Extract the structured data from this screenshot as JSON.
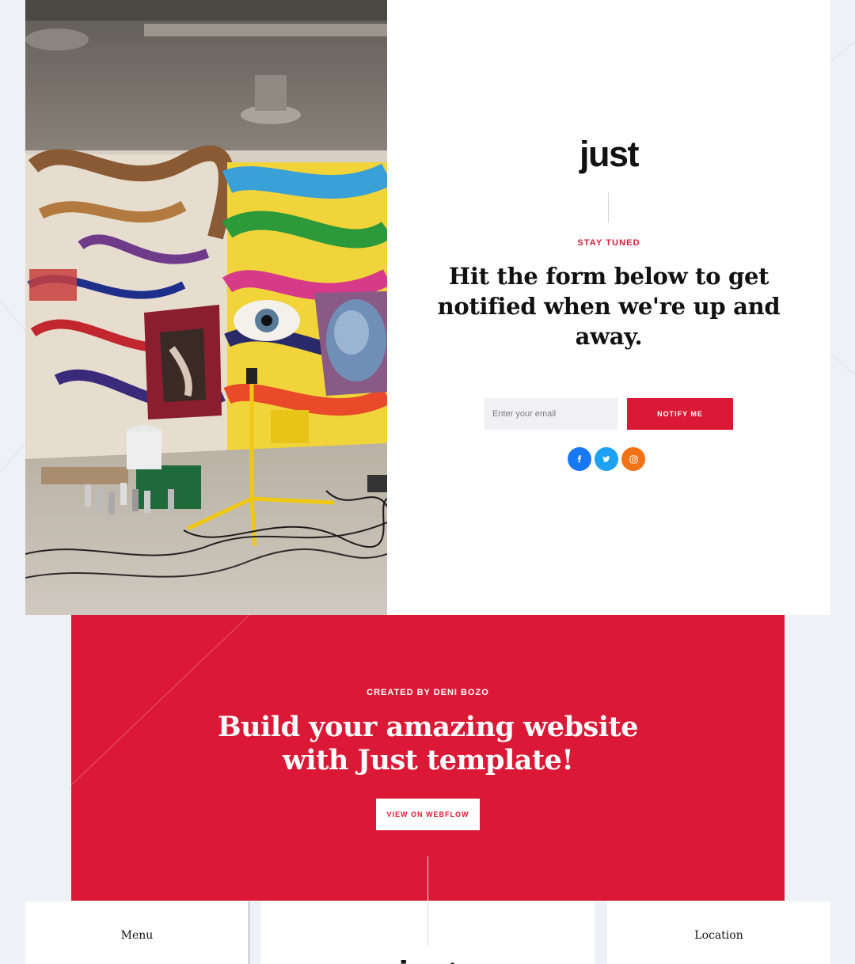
{
  "hero": {
    "logo": "just",
    "eyebrow": "STAY TUNED",
    "heading": "Hit the form below to get notified when we're up and away.",
    "email_placeholder": "Enter your email",
    "notify_label": "NOTIFY ME",
    "image_alt": "Graffiti art studio",
    "socials": [
      {
        "name": "facebook",
        "icon": "facebook-icon",
        "color": "#1877f2"
      },
      {
        "name": "twitter",
        "icon": "twitter-icon",
        "color": "#1da1f2"
      },
      {
        "name": "instagram",
        "icon": "instagram-icon",
        "color": "#f47216"
      }
    ]
  },
  "banner": {
    "eyebrow": "CREATED BY DENI BOZO",
    "heading": "Build your amazing website with Just template!",
    "button_label": "VIEW ON WEBFLOW"
  },
  "footer": {
    "menu_title": "Menu",
    "location_title": "Location",
    "logo": "just"
  },
  "colors": {
    "accent": "#db1936",
    "background": "#eef1f5",
    "text": "#111111"
  }
}
